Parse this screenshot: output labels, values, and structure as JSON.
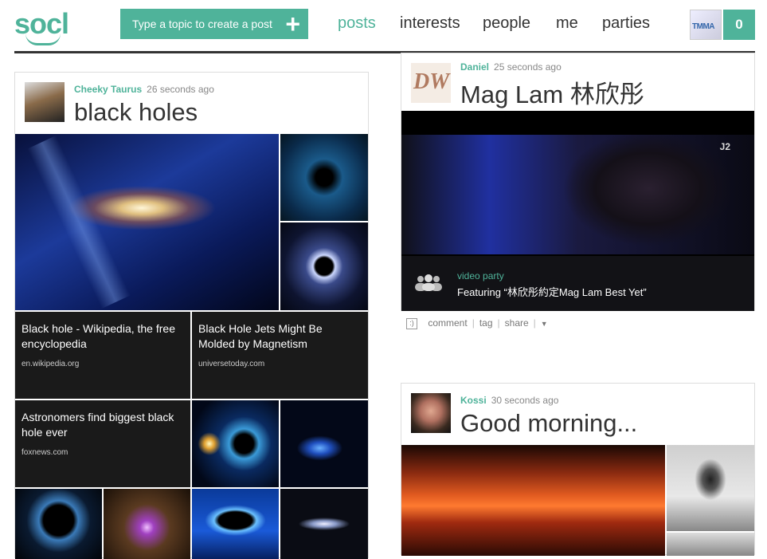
{
  "header": {
    "logo": "socl",
    "create_placeholder": "Type a topic to create a post",
    "nav": [
      "posts",
      "interests",
      "people",
      "me",
      "parties"
    ],
    "notification_count": "0",
    "avatar_text": "TMMA"
  },
  "posts": [
    {
      "author": "Cheeky Taurus",
      "time": "26 seconds ago",
      "title": "black holes",
      "links": [
        {
          "title": "Black hole - Wikipedia, the free encyclopedia",
          "source": "en.wikipedia.org"
        },
        {
          "title": "Black Hole Jets Might Be Molded by Magnetism",
          "source": "universetoday.com"
        },
        {
          "title": "Astronomers find biggest black hole ever",
          "source": "foxnews.com"
        }
      ]
    },
    {
      "author": "Daniel",
      "time": "25 seconds ago",
      "title": "Mag Lam 林欣彤",
      "avatar_text": "DW",
      "video_label": "video party",
      "video_caption": "Featuring “林欣彤約定Mag Lam Best Yet”",
      "channel_logo": "J2",
      "actions": [
        "comment",
        "tag",
        "share"
      ]
    },
    {
      "author": "Kossi",
      "time": "30 seconds ago",
      "title": "Good morning..."
    }
  ],
  "colors": {
    "accent": "#4fb39a",
    "dark_tile": "#1a1a1a"
  }
}
